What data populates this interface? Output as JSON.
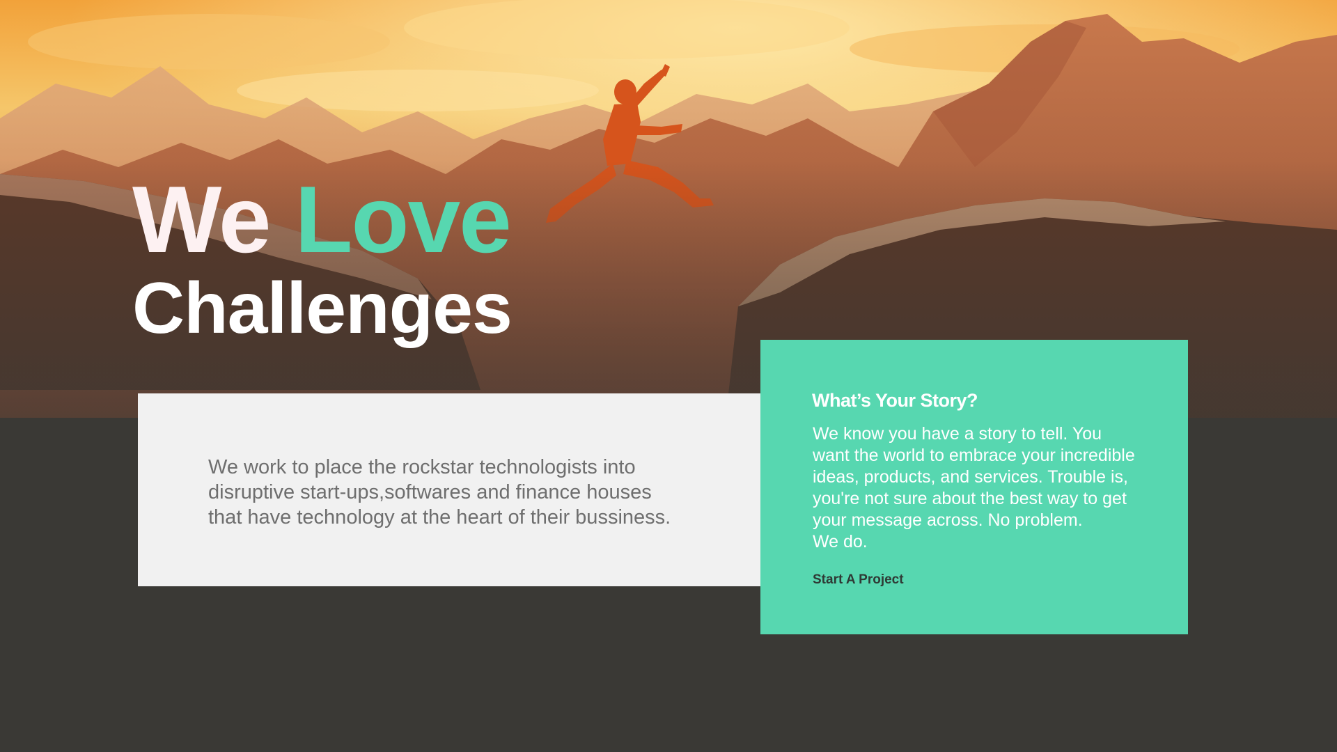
{
  "hero": {
    "headline_word1": "We",
    "headline_word2": "Love",
    "headline_line2": "Challenges",
    "accent_color": "#57d7b0",
    "image": "sunset-mountain-jumper-photo"
  },
  "info_card": {
    "text": "We work to place the rockstar technologists into\ndisruptive  start-ups,softwares and  finance houses\nthat have technology at  the heart of their bussiness."
  },
  "story_card": {
    "title": "What’s Your Story?",
    "body": "We know you have a story to tell. You\nwant the world to embrace your incredible\nideas, products, and services. Trouble is,\nyou're not sure about the best way to get\nyour message across. No problem.\nWe do.",
    "cta_label": "Start A Project",
    "background_color": "#57d7b0"
  }
}
